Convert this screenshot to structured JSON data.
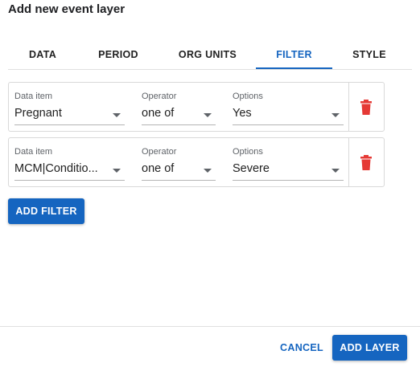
{
  "dialog": {
    "title": "Add new event layer"
  },
  "tabs": [
    {
      "label": "DATA"
    },
    {
      "label": "PERIOD"
    },
    {
      "label": "ORG UNITS"
    },
    {
      "label": "FILTER",
      "active": true
    },
    {
      "label": "STYLE"
    }
  ],
  "filters": [
    {
      "data_item_label": "Data item",
      "data_item_value": "Pregnant",
      "operator_label": "Operator",
      "operator_value": "one of",
      "options_label": "Options",
      "options_value": "Yes"
    },
    {
      "data_item_label": "Data item",
      "data_item_value": "MCM|Conditio...",
      "operator_label": "Operator",
      "operator_value": "one of",
      "options_label": "Options",
      "options_value": "Severe"
    }
  ],
  "buttons": {
    "add_filter": "ADD FILTER",
    "cancel": "CANCEL",
    "add_layer": "ADD LAYER"
  },
  "colors": {
    "accent": "#1565c0",
    "delete": "#e53935"
  },
  "icons": {
    "delete": "trash-can-icon",
    "dropdown": "caret-down-icon"
  }
}
